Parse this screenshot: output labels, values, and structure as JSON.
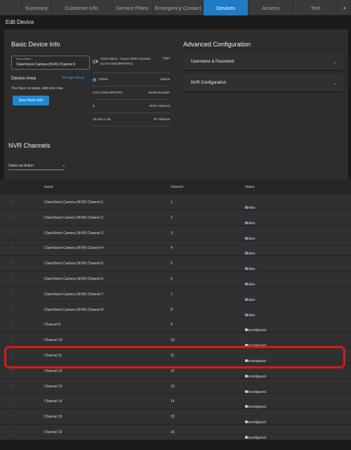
{
  "nav": {
    "tabs": [
      {
        "label": "Summary"
      },
      {
        "label": "Customer Info"
      },
      {
        "label": "Service Plans"
      },
      {
        "label": "Emergency Contact"
      },
      {
        "label": "Devices"
      },
      {
        "label": "Actions"
      },
      {
        "label": "Test"
      }
    ],
    "active": "Devices",
    "more_glyph": "›"
  },
  "page": {
    "title": "Edit Device"
  },
  "basic": {
    "heading": "Basic Device Info",
    "device_name_label": "Device Name *",
    "device_name_value": "ClareVision Camera (NVR) Channel 6",
    "device_area_label": "Device Area",
    "manage_areas": "Manage Areas",
    "no_areas": "You have no areas. Add one now.",
    "save_button": "Save Basic Info"
  },
  "info": {
    "type_line1": "ClareVision - 8-port NVR Camera",
    "type_line2": "(CLR-V200-8PNVR2)",
    "type_label": "Type",
    "status_value": "Online",
    "status_label": "Status",
    "serial_value": "CLR-V200-8PNVR2",
    "serial_label": "Serial Number",
    "channel_value": "6",
    "channel_label": "NVR Channel",
    "ip_value": "10.100.1.29",
    "ip_label": "IP Address"
  },
  "advanced": {
    "heading": "Advanced Configuration",
    "sections": [
      "Username & Password",
      "NVR Configuration"
    ]
  },
  "nvr": {
    "heading": "NVR Channels",
    "action_select": "Select an Action",
    "columns": {
      "name": "Name",
      "channel": "Channel",
      "status": "Status"
    },
    "rows": [
      {
        "name": "ClareVision Camera (NVR) Channel 1",
        "channel": "1",
        "status": "Online"
      },
      {
        "name": "ClareVision Camera (NVR) Channel 2",
        "channel": "2",
        "status": "Online"
      },
      {
        "name": "ClareVision Camera (NVR) Channel 3",
        "channel": "3",
        "status": "Online"
      },
      {
        "name": "ClareVision Camera (NVR) Channel 4",
        "channel": "4",
        "status": "Online"
      },
      {
        "name": "ClareVision Camera (NVR) Channel 5",
        "channel": "5",
        "status": "Online"
      },
      {
        "name": "ClareVision Camera (NVR) Channel 6",
        "channel": "6",
        "status": "Online"
      },
      {
        "name": "ClareVision Camera (NVR) Channel 7",
        "channel": "7",
        "status": "Online"
      },
      {
        "name": "ClareVision Camera (NVR) Channel 8",
        "channel": "8",
        "status": "Online"
      },
      {
        "name": "Channel 9",
        "channel": "9",
        "status": "Unconfigured"
      },
      {
        "name": "Channel 10",
        "channel": "10",
        "status": "Unconfigured"
      },
      {
        "name": "Channel 11",
        "channel": "11",
        "status": "Unconfigured"
      },
      {
        "name": "Channel 12",
        "channel": "12",
        "status": "Unconfigured"
      },
      {
        "name": "Channel 13",
        "channel": "13",
        "status": "Unconfigured"
      },
      {
        "name": "Channel 14",
        "channel": "14",
        "status": "Unconfigured"
      },
      {
        "name": "Channel 15",
        "channel": "15",
        "status": "Unconfigured"
      },
      {
        "name": "Channel 16",
        "channel": "16",
        "status": "Unconfigured"
      }
    ]
  },
  "colors": {
    "accent": "#1f7cc4",
    "online": "#2f8fe0",
    "unconfigured": "#c8c8c8",
    "highlight": "#d8191a"
  },
  "icons": {
    "checkbox": "✓",
    "chevron": "⌄",
    "caret": "▾"
  }
}
